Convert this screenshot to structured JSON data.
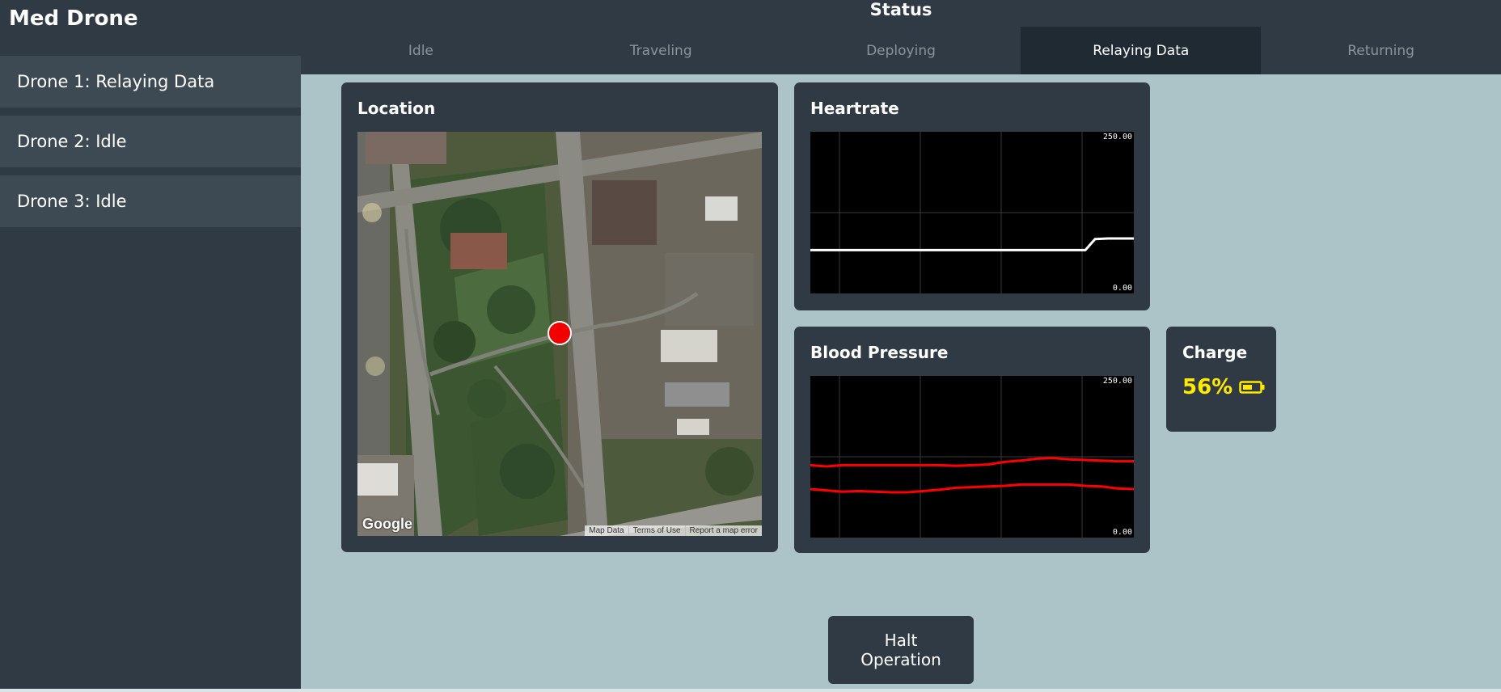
{
  "app": {
    "title": "Med Drone"
  },
  "sidebar": {
    "items": [
      {
        "label": "Drone 1: Relaying Data"
      },
      {
        "label": "Drone 2: Idle"
      },
      {
        "label": "Drone 3: Idle"
      }
    ]
  },
  "header": {
    "title": "Status",
    "tabs": [
      {
        "label": "Idle",
        "active": false
      },
      {
        "label": "Traveling",
        "active": false
      },
      {
        "label": "Deploying",
        "active": false
      },
      {
        "label": "Relaying Data",
        "active": true
      },
      {
        "label": "Returning",
        "active": false
      }
    ]
  },
  "location": {
    "title": "Location",
    "logo": "Google",
    "links": [
      "Map Data",
      "Terms of Use",
      "Report a map error"
    ],
    "marker_color": "#f20000"
  },
  "heartrate": {
    "title": "Heartrate",
    "axis_max": "250.00",
    "axis_min": "0.00",
    "line_color": "#ffffff"
  },
  "blood_pressure": {
    "title": "Blood Pressure",
    "axis_max": "250.00",
    "axis_min": "0.00",
    "line_color": "#ff0000"
  },
  "charge": {
    "title": "Charge",
    "value": "56%",
    "icon": "battery-half-icon",
    "color": "#ffea00"
  },
  "halt": {
    "label": "Halt Operation"
  },
  "chart_data": [
    {
      "type": "line",
      "ylim": [
        0,
        250
      ],
      "x": [
        0,
        10,
        20,
        30,
        40,
        50,
        60,
        70,
        80,
        85,
        88,
        92,
        100
      ],
      "series": [
        {
          "values": [
            67,
            67,
            67,
            67,
            67,
            67,
            67,
            67,
            67,
            67,
            84,
            85,
            85
          ]
        }
      ]
    },
    {
      "type": "line",
      "ylim": [
        0,
        250
      ],
      "x": [
        0,
        5,
        10,
        15,
        20,
        25,
        30,
        35,
        40,
        45,
        50,
        55,
        60,
        65,
        70,
        75,
        80,
        85,
        90,
        95,
        100
      ],
      "series": [
        {
          "values": [
            112,
            110,
            112,
            112,
            112,
            112,
            112,
            112,
            112,
            111,
            112,
            113,
            117,
            119,
            122,
            123,
            121,
            120,
            119,
            118,
            118
          ]
        },
        {
          "values": [
            75,
            73,
            71,
            72,
            71,
            70,
            70,
            72,
            74,
            77,
            78,
            79,
            80,
            82,
            82,
            82,
            82,
            80,
            79,
            76,
            75
          ]
        }
      ]
    }
  ]
}
